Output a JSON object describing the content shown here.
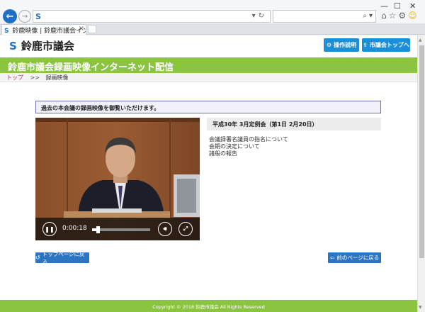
{
  "browser": {
    "tab_title": "鈴鹿映像 | 鈴鹿市議会インタ...",
    "address_url": "",
    "search_placeholder": "",
    "back_icon": "arrow-left",
    "tab_close": "×"
  },
  "header": {
    "logo_text": "鈴鹿市議会",
    "help_button": "操作説明",
    "top_button": "市議会トップへ"
  },
  "banner": {
    "title": "鈴鹿市議会録画映像インターネット配信"
  },
  "breadcrumb": {
    "home": "トップ",
    "separator": ">>",
    "current": "録画映像"
  },
  "notice": "過去の本会議の録画映像を御覧いただけます。",
  "video": {
    "time": "0:00:18",
    "progress": 0.1
  },
  "session": {
    "title": "平成30年 3月定例会（第1日 2月20日）",
    "agenda": [
      "会議録署名議員の指名について",
      "会期の決定について",
      "諸般の報告"
    ]
  },
  "nav": {
    "top_page_button": "トップページに戻る",
    "back_button": "前のページに戻る"
  },
  "footer": "Copyright © 2018 鈴鹿市議会 All Rights Reserved",
  "colors": {
    "accent_green": "#8bc53f",
    "button_blue": "#1a8fd8",
    "breadcrumb_link": "#b0307a"
  }
}
